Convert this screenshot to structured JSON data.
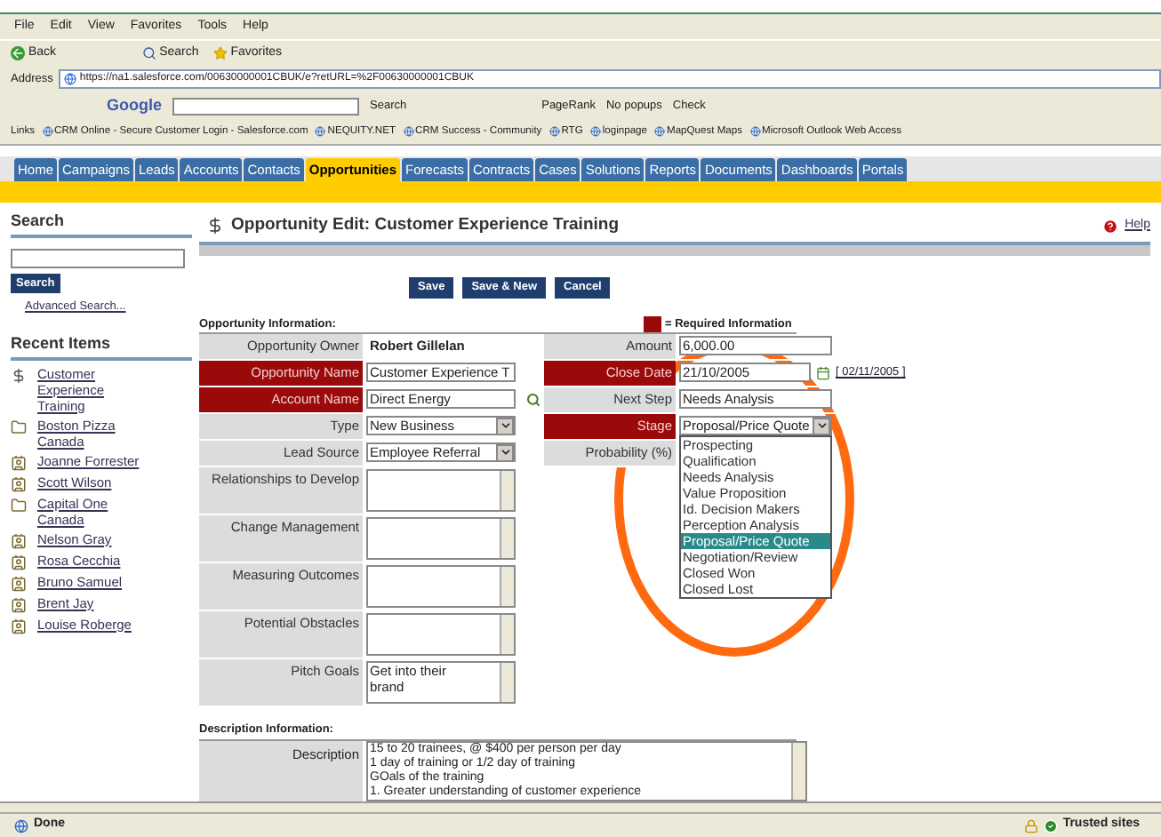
{
  "browser": {
    "menu": [
      "File",
      "Edit",
      "View",
      "Favorites",
      "Tools",
      "Help"
    ],
    "toolbar": [
      "Back",
      "Search",
      "Favorites"
    ],
    "address": {
      "label": "Address",
      "url": "https://na1.salesforce.com/00630000001CBUK/e?retURL=%2F00630000001CBUK"
    },
    "google_toolbar": {
      "brand": "Google",
      "items": [
        "Search",
        "PageRank",
        "No popups",
        "Check"
      ]
    },
    "links": {
      "label": "Links",
      "items": [
        "CRM Online - Secure Customer Login - Salesforce.com",
        "NEQUITY.NET",
        "CRM Success - Community",
        "RTG",
        "loginpage",
        "MapQuest Maps",
        "Microsoft Outlook Web Access"
      ]
    }
  },
  "tabs": [
    {
      "label": "Home",
      "selected": false
    },
    {
      "label": "Campaigns",
      "selected": false
    },
    {
      "label": "Leads",
      "selected": false
    },
    {
      "label": "Accounts",
      "selected": false
    },
    {
      "label": "Contacts",
      "selected": false
    },
    {
      "label": "Opportunities",
      "selected": true
    },
    {
      "label": "Forecasts",
      "selected": false
    },
    {
      "label": "Contracts",
      "selected": false
    },
    {
      "label": "Cases",
      "selected": false
    },
    {
      "label": "Solutions",
      "selected": false
    },
    {
      "label": "Reports",
      "selected": false
    },
    {
      "label": "Documents",
      "selected": false
    },
    {
      "label": "Dashboards",
      "selected": false
    },
    {
      "label": "Portals",
      "selected": false
    }
  ],
  "sidebar": {
    "search_title": "Search",
    "search_button": "Search",
    "advanced_link": "Advanced Search...",
    "recent_title": "Recent Items",
    "recent_items": [
      {
        "label": "Customer Experience Training",
        "kind": "opportunity"
      },
      {
        "label": "Boston Pizza Canada",
        "kind": "account"
      },
      {
        "label": "Joanne Forrester",
        "kind": "contact"
      },
      {
        "label": "Scott Wilson",
        "kind": "contact"
      },
      {
        "label": "Capital One Canada",
        "kind": "account"
      },
      {
        "label": "Nelson Gray",
        "kind": "contact"
      },
      {
        "label": "Rosa Cecchia",
        "kind": "contact"
      },
      {
        "label": "Bruno Samuel",
        "kind": "contact"
      },
      {
        "label": "Brent Jay",
        "kind": "contact"
      },
      {
        "label": "Louise Roberge",
        "kind": "contact"
      }
    ]
  },
  "page": {
    "title": "Opportunity Edit: Customer Experience Training",
    "help": "Help",
    "buttons": [
      "Save",
      "Save & New",
      "Cancel"
    ],
    "section": "Opportunity Information:",
    "required_legend": "= Required Information",
    "left_fields": [
      {
        "label": "Opportunity Owner",
        "kind": "text",
        "value": "Robert Gillelan",
        "required": false
      },
      {
        "label": "Opportunity Name",
        "kind": "input",
        "value": "Customer Experience T",
        "required": true
      },
      {
        "label": "Account Name",
        "kind": "lookup",
        "value": "Direct Energy",
        "required": true
      },
      {
        "label": "Type",
        "kind": "select",
        "value": "New Business",
        "required": false
      },
      {
        "label": "Lead Source",
        "kind": "select",
        "value": "Employee Referral",
        "required": false
      },
      {
        "label": "Relationships to Develop",
        "kind": "textarea",
        "required": false
      },
      {
        "label": "Change Management",
        "kind": "textarea",
        "required": false
      },
      {
        "label": "Measuring Outcomes",
        "kind": "textarea",
        "required": false
      },
      {
        "label": "Potential Obstacles",
        "kind": "textarea",
        "required": false
      },
      {
        "label": "Pitch Goals",
        "kind": "textarea",
        "value": "Get into their brand",
        "required": false
      }
    ],
    "right_fields": [
      {
        "label": "Amount",
        "kind": "input",
        "value": "6,000.00",
        "required": false
      },
      {
        "label": "Close Date",
        "kind": "date",
        "value": "21/10/2005",
        "today": "[ 02/11/2005 ]",
        "required": true
      },
      {
        "label": "Next Step",
        "kind": "input",
        "value": "Needs Analysis",
        "required": false
      },
      {
        "label": "Stage",
        "kind": "select",
        "value": "Proposal/Price Quote",
        "required": true,
        "expanded": true,
        "options": [
          {
            "label": "Prospecting",
            "selected": false
          },
          {
            "label": "Qualification",
            "selected": false
          },
          {
            "label": "Needs Analysis",
            "selected": false
          },
          {
            "label": "Value Proposition",
            "selected": false
          },
          {
            "label": "Id. Decision Makers",
            "selected": false
          },
          {
            "label": "Perception Analysis",
            "selected": false
          },
          {
            "label": "Proposal/Price Quote",
            "selected": true
          },
          {
            "label": "Negotiation/Review",
            "selected": false
          },
          {
            "label": "Closed Won",
            "selected": false
          },
          {
            "label": "Closed Lost",
            "selected": false
          }
        ]
      },
      {
        "label": "Probability (%)",
        "kind": "hidden",
        "required": false
      }
    ],
    "description_section": "Description Information:",
    "description_label": "Description",
    "description_lines": [
      "15 to 20 trainees, @ $400 per person per day",
      "1 day of training or 1/2 day of training",
      "GOals of the training",
      "1. Greater understanding of customer experience"
    ]
  },
  "status_bar": {
    "text": "Done",
    "zone": "Trusted sites"
  }
}
